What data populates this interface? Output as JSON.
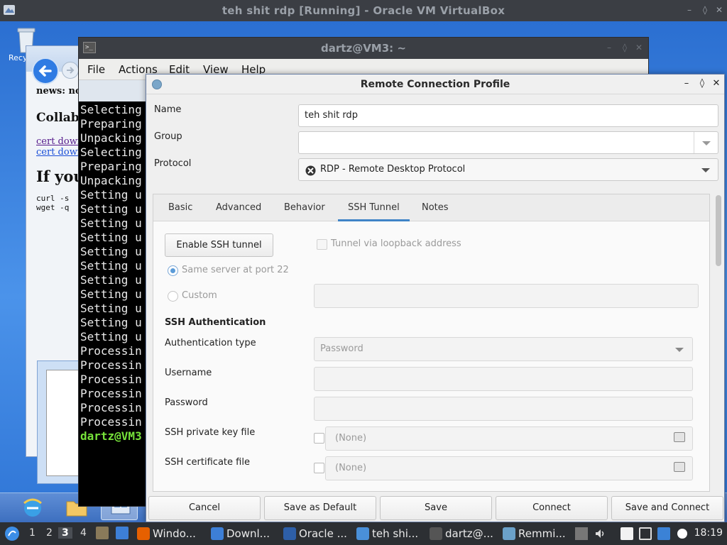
{
  "vbox": {
    "title": "teh shit rdp [Running] - Oracle VM VirtualBox",
    "min_glyph": "–",
    "restore_glyph": "◊",
    "close_glyph": "✕"
  },
  "guest": {
    "recycle_label": "Recy",
    "ie": {
      "news": "news: no",
      "heading2": "Collab",
      "link1": "cert down",
      "link2": "cert down",
      "heading1": "If you",
      "code1": "curl -s",
      "code2": "wget -q"
    }
  },
  "terminal": {
    "title": "dartz@VM3: ~",
    "menu": [
      "File",
      "Actions",
      "Edit",
      "View",
      "Help"
    ],
    "lines": [
      "Selecting",
      "Preparing",
      "Unpacking",
      "Selecting",
      "Preparing",
      "Unpacking",
      "Setting u",
      "Setting u",
      "Setting u",
      "Setting u",
      "Setting u",
      "Setting u",
      "Setting u",
      "Setting u",
      "Setting u",
      "Setting u",
      "Setting u",
      "Processin",
      "Processin",
      "Processin",
      "Processin",
      "Processin",
      "Processin"
    ],
    "prompt": "dartz@VM3"
  },
  "dialog": {
    "title": "Remote Connection Profile",
    "name_label": "Name",
    "name_value": "teh shit rdp",
    "group_label": "Group",
    "group_value": "",
    "protocol_label": "Protocol",
    "protocol_value": "RDP - Remote Desktop Protocol",
    "tabs": [
      "Basic",
      "Advanced",
      "Behavior",
      "SSH Tunnel",
      "Notes"
    ],
    "active_tab": "SSH Tunnel",
    "ssh": {
      "enable_button": "Enable SSH tunnel",
      "loopback_label": "Tunnel via loopback address",
      "same_server_label": "Same server at port 22",
      "custom_label": "Custom",
      "custom_value": "",
      "auth_heading": "SSH Authentication",
      "auth_type_label": "Authentication type",
      "auth_type_value": "Password",
      "username_label": "Username",
      "username_value": "",
      "password_label": "Password",
      "password_value": "",
      "private_key_label": "SSH private key file",
      "private_key_value": "(None)",
      "cert_label": "SSH certificate file",
      "cert_value": "(None)"
    },
    "buttons": {
      "cancel": "Cancel",
      "save_default": "Save as Default",
      "save": "Save",
      "connect": "Connect",
      "save_connect": "Save and Connect"
    }
  },
  "host_taskbar": {
    "workspaces": [
      "1",
      "2",
      "3",
      "4"
    ],
    "active_workspace": "3",
    "items": [
      {
        "label": "Windo...",
        "icon": "firefox-icon",
        "color": "#e66000"
      },
      {
        "label": "Downl...",
        "icon": "folder-icon",
        "color": "#3d7fd6"
      },
      {
        "label": "Oracle ...",
        "icon": "virtualbox-icon",
        "color": "#2e5fa8"
      },
      {
        "label": "teh shi...",
        "icon": "vm-window-icon",
        "color": "#4a90d9"
      },
      {
        "label": "dartz@...",
        "icon": "terminal-icon",
        "color": "#555555"
      },
      {
        "label": "Remmi...",
        "icon": "remmina-icon",
        "color": "#6ba1c9"
      }
    ],
    "clock": "18:19"
  }
}
